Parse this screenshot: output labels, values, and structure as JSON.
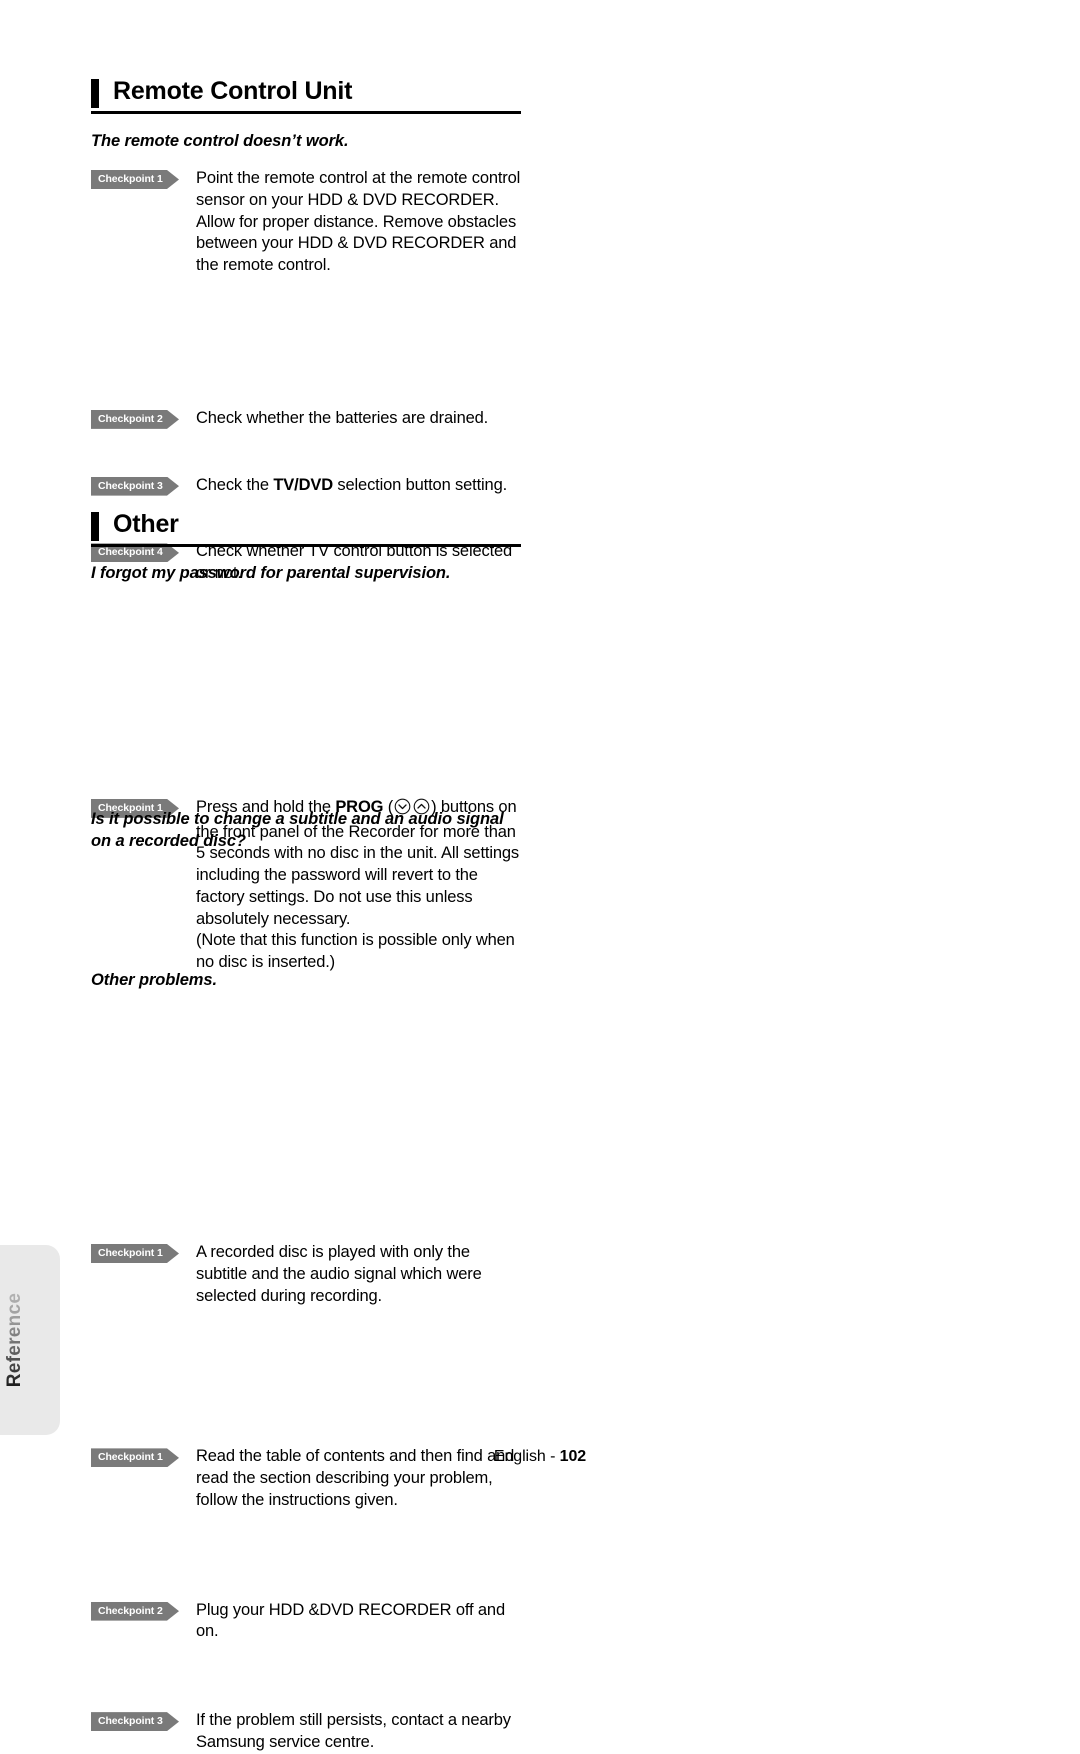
{
  "side_tab": {
    "label": "Reference"
  },
  "footer": {
    "language": "English",
    "separator": "-",
    "page": "102"
  },
  "sections": [
    {
      "heading": "Remote Control Unit",
      "questions": [
        {
          "title": "The remote control doesn’t work.",
          "checkpoints": [
            {
              "badge": "Checkpoint 1",
              "text": "Point the remote control at the remote control sensor on your HDD & DVD RECORDER. Allow for proper distance. Remove obstacles between your HDD & DVD RECORDER and the remote control."
            },
            {
              "badge": "Checkpoint 2",
              "text": "Check whether the batteries are drained."
            },
            {
              "badge": "Checkpoint 3",
              "pre": "Check the ",
              "bold": "TV/DVD",
              "post": " selection button setting."
            },
            {
              "badge": "Checkpoint 4",
              "text": "Check whether TV control button is selected or not."
            }
          ]
        }
      ]
    },
    {
      "heading": "Other",
      "questions": [
        {
          "title": "I forgot my password for parental supervision.",
          "checkpoints": [
            {
              "badge": "Checkpoint 1",
              "pre": "Press and hold the ",
              "bold": "PROG",
              "icons": [
                "chevron-down-circle-icon",
                "chevron-up-circle-icon"
              ],
              "post": " buttons on the front panel of the Recorder for more than 5 seconds with no disc in the unit. All settings including the password will revert to the factory settings. Do not use this unless absolutely necessary.",
              "second_line": "(Note that this function is possible only when no disc is inserted.)"
            }
          ]
        },
        {
          "title": "Is it possible to change a subtitle and an audio signal on a recorded disc?",
          "checkpoints": [
            {
              "badge": "Checkpoint 1",
              "text": "A recorded disc is played with only the subtitle and the audio signal which were selected during recording."
            }
          ]
        },
        {
          "title": "Other problems.",
          "checkpoints": [
            {
              "badge": "Checkpoint 1",
              "text": "Read the table of contents and then find and read the section describing your problem, follow the instructions given."
            },
            {
              "badge": "Checkpoint 2",
              "text": "Plug  your HDD &DVD RECORDER off and on."
            },
            {
              "badge": "Checkpoint 3",
              "text": "If the problem still persists, contact a nearby Samsung service centre."
            }
          ]
        }
      ]
    }
  ]
}
